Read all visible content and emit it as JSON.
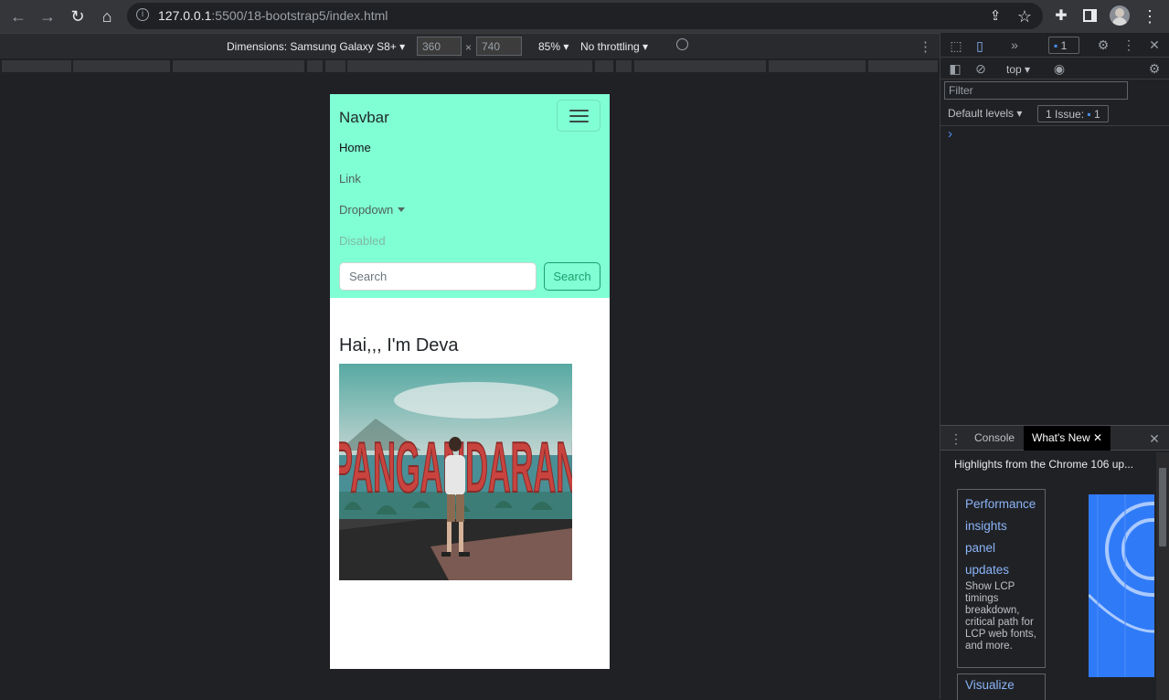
{
  "browser": {
    "url_host": "127.0.0.1",
    "url_rest": ":5500/18-bootstrap5/index.html"
  },
  "device_toolbar": {
    "dimensions_label": "Dimensions: Samsung Galaxy S8+",
    "width": "360",
    "times": "×",
    "height": "740",
    "zoom": "85%",
    "throttling": "No throttling"
  },
  "page": {
    "navbar": {
      "brand": "Navbar",
      "links": [
        {
          "label": "Home",
          "state": "active"
        },
        {
          "label": "Link",
          "state": "normal"
        },
        {
          "label": "Dropdown",
          "state": "dropdown"
        },
        {
          "label": "Disabled",
          "state": "disabled"
        }
      ],
      "search_placeholder": "Search",
      "search_button": "Search",
      "bg_color": "#80ffd5"
    },
    "hero_title": "Hai,,, I'm Deva",
    "photo_sign_text": "PANGANDARAN"
  },
  "devtools": {
    "messages_badge": "1",
    "context": "top",
    "filter_placeholder": "Filter",
    "levels": "Default levels",
    "issues_badge": "1 Issue:",
    "issues_count": "1",
    "prompt": "›",
    "drawer": {
      "tabs": [
        "Console",
        "What's New"
      ],
      "active_tab": "What's New",
      "header": "Highlights from the Chrome 106 up...",
      "card1_title_lines": [
        "Performance",
        "insights",
        "panel",
        "updates"
      ],
      "card1_desc": "Show LCP timings breakdown, critical path for LCP web fonts, and more.",
      "card2_title": "Visualize"
    }
  }
}
